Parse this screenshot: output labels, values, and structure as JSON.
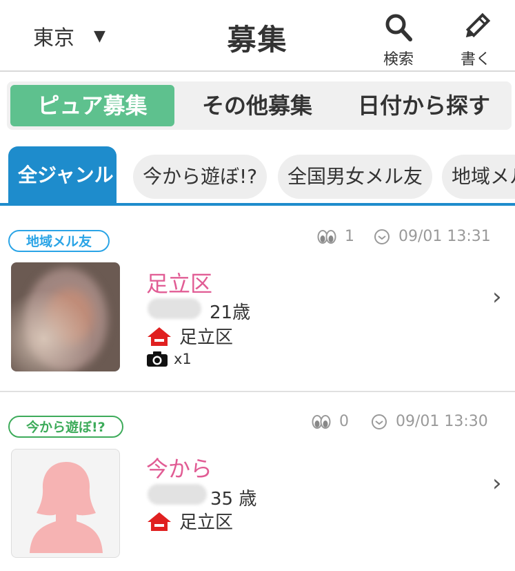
{
  "header": {
    "region_label": "東京",
    "region_caret": "▼",
    "title": "募集",
    "search_label": "検索",
    "write_label": "書く"
  },
  "segments": [
    {
      "label": "ピュア募集",
      "active": true
    },
    {
      "label": "その他募集",
      "active": false
    },
    {
      "label": "日付から探す",
      "active": false
    }
  ],
  "genres": [
    {
      "label": "全ジャンル",
      "active": true
    },
    {
      "label": "今から遊ぼ!?",
      "active": false
    },
    {
      "label": "全国男女メル友",
      "active": false
    },
    {
      "label": "地域メル友",
      "active": false
    }
  ],
  "posts": [
    {
      "tag": "地域メル友",
      "views": "1",
      "datetime": "09/01 13:31",
      "title": "足立区",
      "age": "21歳",
      "location": "足立区",
      "photo_count": "x1",
      "chevron": "›"
    },
    {
      "tag": "今から遊ぼ!?",
      "views": "0",
      "datetime": "09/01 13:30",
      "title": "今から",
      "age": "35 歳",
      "location": "足立区",
      "chevron": "›"
    }
  ],
  "colors": {
    "accent_green": "#5ec18e",
    "accent_blue": "#1e8ccc",
    "title_pink": "#e15c94",
    "home_red": "#e02020"
  }
}
